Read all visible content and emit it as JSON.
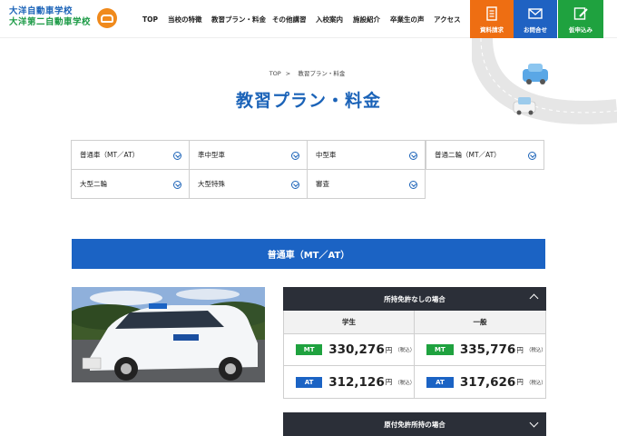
{
  "header": {
    "logo_line1": "大洋自動車学校",
    "logo_line2": "大洋第二自動車学校",
    "nav": [
      "TOP",
      "当校の特徴",
      "教習プラン・料金",
      "その他講習",
      "入校案内",
      "施設紹介",
      "卒業生の声",
      "アクセス"
    ],
    "cta": [
      {
        "label": "資料請求",
        "icon": "document-icon",
        "color": "#ee6e12"
      },
      {
        "label": "お問合せ",
        "icon": "mail-icon",
        "color": "#1f62c2"
      },
      {
        "label": "仮申込み",
        "icon": "pencil-icon",
        "color": "#1fa23f"
      }
    ]
  },
  "breadcrumb": {
    "home": "TOP",
    "separator": ">",
    "current": "教習プラン・料金"
  },
  "page_title": "教習プラン・料金",
  "categories": [
    "普通車（MT／AT）",
    "準中型車",
    "中型車",
    "普通二輪（MT／AT）",
    "大型二輪",
    "大型特殊",
    "審査"
  ],
  "section": {
    "title": "普通車（MT／AT）",
    "table1": {
      "heading": "所持免許なしの場合",
      "columns": [
        "学生",
        "一般"
      ],
      "rows": [
        {
          "type": "MT",
          "values": [
            "330,276",
            "335,776"
          ]
        },
        {
          "type": "AT",
          "values": [
            "312,126",
            "317,626"
          ]
        }
      ],
      "yen": "円",
      "tax": "（税込）"
    },
    "table2": {
      "heading": "原付免許所持の場合"
    }
  },
  "colors": {
    "brand_blue": "#1b63c4",
    "green": "#1fa23f",
    "orange": "#ee6e12",
    "dark": "#2b2f38"
  }
}
